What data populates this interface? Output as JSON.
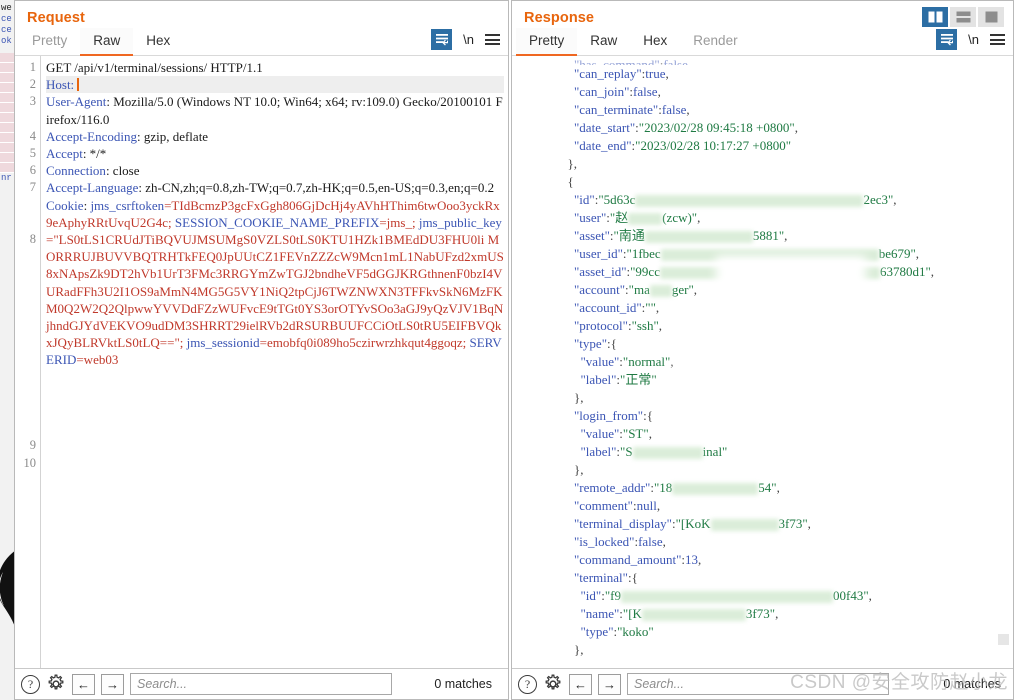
{
  "app": {
    "watermark": "CSDN @安全攻防赵小龙"
  },
  "layout_toggles": [
    {
      "name": "side-by-side",
      "icon": "two-column-icon",
      "active": true
    },
    {
      "name": "stacked",
      "icon": "stacked-rows-icon",
      "active": false
    },
    {
      "name": "single",
      "icon": "single-pane-icon",
      "active": false
    }
  ],
  "request": {
    "title": "Request",
    "tabs": [
      {
        "label": "Pretty",
        "active": false,
        "disabled": false
      },
      {
        "label": "Raw",
        "active": true,
        "disabled": false
      },
      {
        "label": "Hex",
        "active": false,
        "disabled": false
      }
    ],
    "tools": [
      {
        "name": "format-wrap-button",
        "icon": "word-wrap-icon"
      },
      {
        "name": "newline-toggle",
        "icon": "newline-icon",
        "label": "\\n"
      },
      {
        "name": "options-menu-button",
        "icon": "hamburger-icon"
      }
    ],
    "line_numbers": [
      "1",
      "2",
      "3",
      "",
      "4",
      "5",
      "6",
      "7",
      "",
      "",
      "8",
      "",
      "",
      "",
      "",
      "",
      "",
      "",
      "",
      "",
      "",
      "",
      "9",
      "10"
    ],
    "lines": [
      {
        "n": 1,
        "segs": [
          {
            "t": "GET /api/v1/terminal/sessions/ HTTP/1.1",
            "c": "c-plain"
          }
        ]
      },
      {
        "n": 2,
        "highlight": true,
        "segs": [
          {
            "t": "Host:",
            "c": "c-key"
          },
          {
            "t": " ",
            "c": "c-plain"
          },
          {
            "t": "|caret|",
            "c": "caret"
          }
        ]
      },
      {
        "n": 3,
        "segs": [
          {
            "t": "User-Agent",
            "c": "c-key"
          },
          {
            "t": ": Mozilla/5.0 (Windows NT 10.0; Win64; x64; rv:109.0) Gecko/20100101 Firefox/116.0",
            "c": "c-plain"
          }
        ]
      },
      {
        "n": 4,
        "segs": [
          {
            "t": "Accept-Encoding",
            "c": "c-key"
          },
          {
            "t": ": gzip, deflate",
            "c": "c-plain"
          }
        ]
      },
      {
        "n": 5,
        "segs": [
          {
            "t": "Accept",
            "c": "c-key"
          },
          {
            "t": ": */*",
            "c": "c-plain"
          }
        ]
      },
      {
        "n": 6,
        "segs": [
          {
            "t": "Connection",
            "c": "c-key"
          },
          {
            "t": ": close",
            "c": "c-plain"
          }
        ]
      },
      {
        "n": 7,
        "segs": [
          {
            "t": "Accept-Language",
            "c": "c-key"
          },
          {
            "t": ": zh-CN,zh;q=0.8,zh-TW;q=0.7,zh-HK;q=0.5,en-US;q=0.3,en;q=0.2",
            "c": "c-plain"
          }
        ]
      },
      {
        "n": 8,
        "segs": [
          {
            "t": "Cookie",
            "c": "c-key"
          },
          {
            "t": ": ",
            "c": "c-plain"
          },
          {
            "t": "jms_csrftoken",
            "c": "c-ckname"
          },
          {
            "t": "=TIdBcmzP3gcFxGgh806GjDcHj4yAVhHThim6twOoo3yckRx9eAphyRRtUvqU2G4c; ",
            "c": "c-cookie"
          },
          {
            "t": "SESSION_COOKIE_NAME_PREFIX",
            "c": "c-ckname"
          },
          {
            "t": "=jms_; ",
            "c": "c-cookie"
          },
          {
            "t": "jms_public_key",
            "c": "c-ckname"
          },
          {
            "t": "=\"LS0tLS1CRUdJTiBQVUJMSUMgS0VZLS0tLS0KTU1HZk1BMEdDU3FHU0li MORRRUJBUVVBQTRHTkFEQ0JpUUtCZ1FEVnZZZcW9Mcn1mL1NabUFzd2xmUS8xNApsZk9DT2hVb1UrT3FMc3RRGYmZwTGJ2bndheVF5dGGJKRGthnenF0bzI4VURadFFh3U2I1OS9aMmN4MG5G5VY1NiQ2tpCjJ6TWZNWXN3TFFkvSkN6MzFKM0Q2W2Q2QlpwwYVVDdFZzWUFvcE9tTGt0YS3orOTYvSOo3aGJ9yQzVJV1BqNjhndGJYdVEKVO9udDM3SHRRT29ielRVb2dRSURBUUFCCiOtLS0tRU5EIFBVQkxJQyBLRVktLS0tLQ==\"; ",
            "c": "c-cookie"
          },
          {
            "t": "jms_sessionid",
            "c": "c-ckname"
          },
          {
            "t": "=emobfq0i089ho5czirwrzhkqut4ggoqz; ",
            "c": "c-cookie"
          },
          {
            "t": "SERVERID",
            "c": "c-ckname"
          },
          {
            "t": "=web03",
            "c": "c-cookie"
          }
        ]
      }
    ],
    "bottom": {
      "help_icon": "help-icon",
      "settings_icon": "gear-icon",
      "prev_icon": "arrow-left-icon",
      "next_icon": "arrow-right-icon",
      "search_placeholder": "Search...",
      "search_value": "",
      "matches": "0 matches"
    }
  },
  "response": {
    "title": "Response",
    "tabs": [
      {
        "label": "Pretty",
        "active": true,
        "disabled": false
      },
      {
        "label": "Raw",
        "active": false,
        "disabled": false
      },
      {
        "label": "Hex",
        "active": false,
        "disabled": false
      },
      {
        "label": "Render",
        "active": false,
        "disabled": true
      }
    ],
    "tools": [
      {
        "name": "format-wrap-button",
        "icon": "word-wrap-icon"
      },
      {
        "name": "newline-toggle",
        "icon": "newline-icon",
        "label": "\\n"
      },
      {
        "name": "options-menu-button",
        "icon": "hamburger-icon"
      }
    ],
    "body_lines": [
      {
        "indent": 4,
        "clipped": true,
        "segs": [
          {
            "t": "\"has_command\"",
            "c": "r-key"
          },
          {
            "t": ":",
            "c": "r-punc"
          },
          {
            "t": "false",
            "c": "r-lit"
          },
          {
            "t": ",",
            "c": "r-punc"
          }
        ]
      },
      {
        "indent": 4,
        "segs": [
          {
            "t": "\"can_replay\"",
            "c": "r-key"
          },
          {
            "t": ":",
            "c": "r-punc"
          },
          {
            "t": "true",
            "c": "r-lit"
          },
          {
            "t": ",",
            "c": "r-punc"
          }
        ]
      },
      {
        "indent": 4,
        "segs": [
          {
            "t": "\"can_join\"",
            "c": "r-key"
          },
          {
            "t": ":",
            "c": "r-punc"
          },
          {
            "t": "false",
            "c": "r-lit"
          },
          {
            "t": ",",
            "c": "r-punc"
          }
        ]
      },
      {
        "indent": 4,
        "segs": [
          {
            "t": "\"can_terminate\"",
            "c": "r-key"
          },
          {
            "t": ":",
            "c": "r-punc"
          },
          {
            "t": "false",
            "c": "r-lit"
          },
          {
            "t": ",",
            "c": "r-punc"
          }
        ]
      },
      {
        "indent": 4,
        "segs": [
          {
            "t": "\"date_start\"",
            "c": "r-key"
          },
          {
            "t": ":",
            "c": "r-punc"
          },
          {
            "t": "\"2023/02/28 09:45:18 +0800\"",
            "c": "r-str"
          },
          {
            "t": ",",
            "c": "r-punc"
          }
        ]
      },
      {
        "indent": 4,
        "segs": [
          {
            "t": "\"date_end\"",
            "c": "r-key"
          },
          {
            "t": ":",
            "c": "r-punc"
          },
          {
            "t": "\"2023/02/28 10:17:27 +0800\"",
            "c": "r-str"
          }
        ]
      },
      {
        "indent": 2,
        "segs": [
          {
            "t": "},",
            "c": "r-punc"
          }
        ]
      },
      {
        "indent": 2,
        "segs": [
          {
            "t": "{",
            "c": "r-punc"
          }
        ]
      },
      {
        "indent": 4,
        "segs": [
          {
            "t": "\"id\"",
            "c": "r-key"
          },
          {
            "t": ":",
            "c": "r-punc"
          },
          {
            "t": "\"5d63c",
            "c": "r-str"
          },
          {
            "t": "REDACT:228",
            "c": "redact"
          },
          {
            "t": "2ec3\"",
            "c": "r-str"
          },
          {
            "t": ",",
            "c": "r-punc"
          }
        ]
      },
      {
        "indent": 4,
        "segs": [
          {
            "t": "\"user\"",
            "c": "r-key"
          },
          {
            "t": ":",
            "c": "r-punc"
          },
          {
            "t": "\"赵",
            "c": "r-str"
          },
          {
            "t": "REDACT:34",
            "c": "redact"
          },
          {
            "t": "(zcw)\"",
            "c": "r-str"
          },
          {
            "t": ",",
            "c": "r-punc"
          }
        ]
      },
      {
        "indent": 4,
        "segs": [
          {
            "t": "\"asset\"",
            "c": "r-key"
          },
          {
            "t": ":",
            "c": "r-punc"
          },
          {
            "t": "\"南通",
            "c": "r-str"
          },
          {
            "t": "REDACT:108",
            "c": "redact"
          },
          {
            "t": "5881\"",
            "c": "r-str"
          },
          {
            "t": ",",
            "c": "r-punc"
          }
        ]
      },
      {
        "indent": 4,
        "segs": [
          {
            "t": "\"user_id\"",
            "c": "r-key"
          },
          {
            "t": ":",
            "c": "r-punc"
          },
          {
            "t": "\"1fbec",
            "c": "r-str"
          },
          {
            "t": "REDACT:218",
            "c": "redact"
          },
          {
            "t": "be679\"",
            "c": "r-str"
          },
          {
            "t": ",",
            "c": "r-punc"
          }
        ]
      },
      {
        "indent": 4,
        "segs": [
          {
            "t": "\"asset_id\"",
            "c": "r-key"
          },
          {
            "t": ":",
            "c": "r-punc"
          },
          {
            "t": "\"99cc",
            "c": "r-str"
          },
          {
            "t": "REDACT:220",
            "c": "redact"
          },
          {
            "t": "63780d1\"",
            "c": "r-str"
          },
          {
            "t": ",",
            "c": "r-punc"
          }
        ]
      },
      {
        "indent": 4,
        "segs": [
          {
            "t": "\"account\"",
            "c": "r-key"
          },
          {
            "t": ":",
            "c": "r-punc"
          },
          {
            "t": "\"ma",
            "c": "r-str"
          },
          {
            "t": "REDACT:22",
            "c": "redact"
          },
          {
            "t": "ger\"",
            "c": "r-str"
          },
          {
            "t": ",",
            "c": "r-punc"
          }
        ]
      },
      {
        "indent": 4,
        "segs": [
          {
            "t": "\"account_id\"",
            "c": "r-key"
          },
          {
            "t": ":",
            "c": "r-punc"
          },
          {
            "t": "\"\"",
            "c": "r-str"
          },
          {
            "t": ",",
            "c": "r-punc"
          }
        ]
      },
      {
        "indent": 4,
        "segs": [
          {
            "t": "\"protocol\"",
            "c": "r-key"
          },
          {
            "t": ":",
            "c": "r-punc"
          },
          {
            "t": "\"ssh\"",
            "c": "r-str"
          },
          {
            "t": ",",
            "c": "r-punc"
          }
        ]
      },
      {
        "indent": 4,
        "segs": [
          {
            "t": "\"type\"",
            "c": "r-key"
          },
          {
            "t": ":",
            "c": "r-punc"
          },
          {
            "t": "{",
            "c": "r-punc"
          }
        ]
      },
      {
        "indent": 6,
        "segs": [
          {
            "t": "\"value\"",
            "c": "r-key"
          },
          {
            "t": ":",
            "c": "r-punc"
          },
          {
            "t": "\"normal\"",
            "c": "r-str"
          },
          {
            "t": ",",
            "c": "r-punc"
          }
        ]
      },
      {
        "indent": 6,
        "segs": [
          {
            "t": "\"label\"",
            "c": "r-key"
          },
          {
            "t": ":",
            "c": "r-punc"
          },
          {
            "t": "\"正常\"",
            "c": "r-str"
          }
        ]
      },
      {
        "indent": 4,
        "segs": [
          {
            "t": "},",
            "c": "r-punc"
          }
        ]
      },
      {
        "indent": 4,
        "segs": [
          {
            "t": "\"login_from\"",
            "c": "r-key"
          },
          {
            "t": ":",
            "c": "r-punc"
          },
          {
            "t": "{",
            "c": "r-punc"
          }
        ]
      },
      {
        "indent": 6,
        "segs": [
          {
            "t": "\"value\"",
            "c": "r-key"
          },
          {
            "t": ":",
            "c": "r-punc"
          },
          {
            "t": "\"ST\"",
            "c": "r-str"
          },
          {
            "t": ",",
            "c": "r-punc"
          }
        ]
      },
      {
        "indent": 6,
        "segs": [
          {
            "t": "\"label\"",
            "c": "r-key"
          },
          {
            "t": ":",
            "c": "r-punc"
          },
          {
            "t": "\"S",
            "c": "r-str"
          },
          {
            "t": "REDACT:70",
            "c": "redact"
          },
          {
            "t": "inal\"",
            "c": "r-str"
          }
        ]
      },
      {
        "indent": 4,
        "segs": [
          {
            "t": "},",
            "c": "r-punc"
          }
        ]
      },
      {
        "indent": 4,
        "segs": [
          {
            "t": "\"remote_addr\"",
            "c": "r-key"
          },
          {
            "t": ":",
            "c": "r-punc"
          },
          {
            "t": "\"18",
            "c": "r-str"
          },
          {
            "t": "REDACT:86",
            "c": "redact"
          },
          {
            "t": "54\"",
            "c": "r-str"
          },
          {
            "t": ",",
            "c": "r-punc"
          }
        ]
      },
      {
        "indent": 4,
        "segs": [
          {
            "t": "\"comment\"",
            "c": "r-key"
          },
          {
            "t": ":",
            "c": "r-punc"
          },
          {
            "t": "null",
            "c": "r-lit"
          },
          {
            "t": ",",
            "c": "r-punc"
          }
        ]
      },
      {
        "indent": 4,
        "segs": [
          {
            "t": "\"terminal_display\"",
            "c": "r-key"
          },
          {
            "t": ":",
            "c": "r-punc"
          },
          {
            "t": "\"[KoK",
            "c": "r-str"
          },
          {
            "t": "REDACT:68",
            "c": "redact"
          },
          {
            "t": "3f73\"",
            "c": "r-str"
          },
          {
            "t": ",",
            "c": "r-punc"
          }
        ]
      },
      {
        "indent": 4,
        "segs": [
          {
            "t": "\"is_locked\"",
            "c": "r-key"
          },
          {
            "t": ":",
            "c": "r-punc"
          },
          {
            "t": "false",
            "c": "r-lit"
          },
          {
            "t": ",",
            "c": "r-punc"
          }
        ]
      },
      {
        "indent": 4,
        "segs": [
          {
            "t": "\"command_amount\"",
            "c": "r-key"
          },
          {
            "t": ":",
            "c": "r-punc"
          },
          {
            "t": "13",
            "c": "r-num"
          },
          {
            "t": ",",
            "c": "r-punc"
          }
        ]
      },
      {
        "indent": 4,
        "segs": [
          {
            "t": "\"terminal\"",
            "c": "r-key"
          },
          {
            "t": ":",
            "c": "r-punc"
          },
          {
            "t": "{",
            "c": "r-punc"
          }
        ]
      },
      {
        "indent": 6,
        "segs": [
          {
            "t": "\"id\"",
            "c": "r-key"
          },
          {
            "t": ":",
            "c": "r-punc"
          },
          {
            "t": "\"f9",
            "c": "r-str"
          },
          {
            "t": "REDACT:212",
            "c": "redact"
          },
          {
            "t": "00f43\"",
            "c": "r-str"
          },
          {
            "t": ",",
            "c": "r-punc"
          }
        ]
      },
      {
        "indent": 6,
        "segs": [
          {
            "t": "\"name\"",
            "c": "r-key"
          },
          {
            "t": ":",
            "c": "r-punc"
          },
          {
            "t": "\"[K",
            "c": "r-str"
          },
          {
            "t": "REDACT:104",
            "c": "redact"
          },
          {
            "t": "3f73\"",
            "c": "r-str"
          },
          {
            "t": ",",
            "c": "r-punc"
          }
        ]
      },
      {
        "indent": 6,
        "segs": [
          {
            "t": "\"type\"",
            "c": "r-key"
          },
          {
            "t": ":",
            "c": "r-punc"
          },
          {
            "t": "\"koko\"",
            "c": "r-str"
          }
        ]
      },
      {
        "indent": 4,
        "segs": [
          {
            "t": "},",
            "c": "r-punc"
          }
        ]
      }
    ],
    "bottom": {
      "help_icon": "help-icon",
      "settings_icon": "gear-icon",
      "prev_icon": "arrow-left-icon",
      "next_icon": "arrow-right-icon",
      "search_placeholder": "Search...",
      "search_value": "",
      "matches": "0 matches"
    }
  },
  "background_window": {
    "fragments": [
      "we",
      "ce",
      "ce",
      "ok",
      "nr"
    ]
  }
}
